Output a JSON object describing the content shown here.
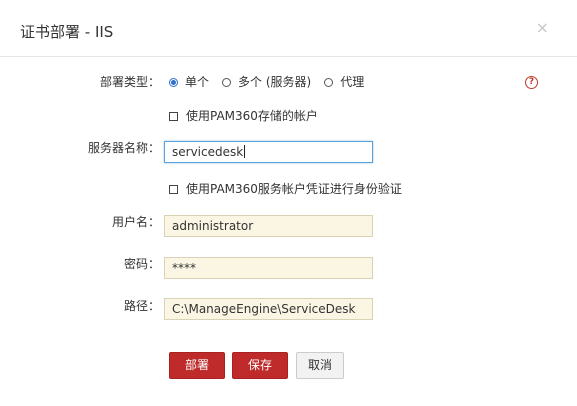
{
  "dialog": {
    "title": "证书部署 - IIS",
    "close_glyph": "×"
  },
  "form": {
    "deploy_type": {
      "label": "部署类型：",
      "options": [
        {
          "label": "单个",
          "checked": true
        },
        {
          "label": "多个 (服务器)",
          "checked": false
        },
        {
          "label": "代理",
          "checked": false
        }
      ],
      "help_glyph": "?"
    },
    "use_pam_account": {
      "label": "使用PAM360存储的帐户",
      "checked": false
    },
    "server_name": {
      "label": "服务器名称：",
      "value": "servicedesk"
    },
    "use_pam_service_account": {
      "label": "使用PAM360服务帐户凭证进行身份验证",
      "checked": false
    },
    "username": {
      "label": "用户名：",
      "value": "administrator"
    },
    "password": {
      "label": "密码：",
      "value": "****"
    },
    "path": {
      "label": "路径：",
      "value": "C:\\ManageEngine\\ServiceDesk"
    }
  },
  "buttons": {
    "deploy": "部署",
    "save": "保存",
    "cancel": "取消"
  },
  "colors": {
    "primary_button": "#bf2a2a",
    "radio_checked": "#2e6fd1",
    "input_background": "#fbf6e3",
    "help_icon": "#c0392b"
  }
}
